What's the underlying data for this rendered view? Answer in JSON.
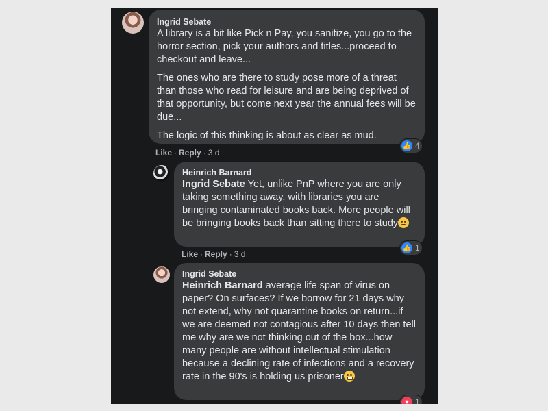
{
  "comments": [
    {
      "author": "Ingrid Sebate",
      "paragraphs": [
        "A library is a bit like Pick n Pay, you sanitize, you go to the horror section, pick your authors and titles...proceed to checkout and leave...",
        "The ones who are there to study pose more of a threat than those who read for leisure and are being deprived of that opportunity, but come next year the annual fees will be due...",
        "The logic of this thinking is about as clear as mud."
      ],
      "actions": {
        "like": "Like",
        "reply": "Reply",
        "time": "3 d"
      },
      "reaction": {
        "type": "like-icon",
        "count": "4"
      }
    },
    {
      "author": "Heinrich Barnard",
      "mention": "Ingrid Sebate",
      "text": " Yet, unlike PnP where you are only taking something away, with libraries you are bringing contaminated books back. More people will be bringing books back than sitting there to study",
      "emoji": "rolling-eyes-emoji",
      "actions": {
        "like": "Like",
        "reply": "Reply",
        "time": "3 d"
      },
      "reaction": {
        "type": "like-icon",
        "count": "1"
      }
    },
    {
      "author": "Ingrid Sebate",
      "mention": "Heinrich Barnard",
      "text": " average life span of virus on paper? On surfaces? If we borrow for 21 days why not extend, why not quarantine books on return...if we are deemed not contagious after 10 days then tell me why are we not thinking out of the box...how many people are without intellectual stimulation because a declining rate of infections and a recovery rate in the 90's is holding us prisoner",
      "emoji": "grimacing-emoji",
      "reaction": {
        "type": "heart-icon",
        "count": "1"
      }
    }
  ],
  "colors": {
    "bubble": "#3a3b3c",
    "page": "#18191a",
    "like": "#2d88ff",
    "love": "#f33e58"
  }
}
